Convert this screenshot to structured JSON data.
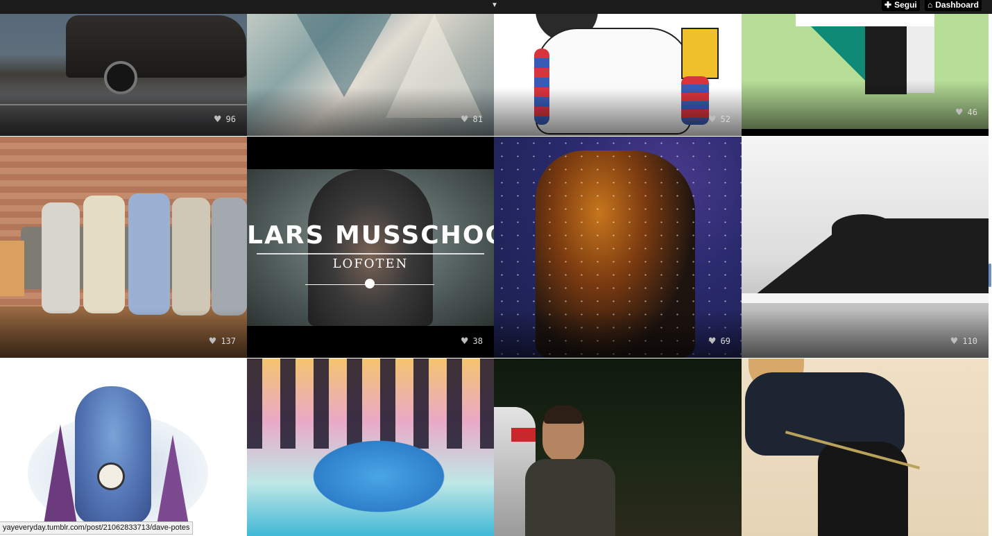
{
  "topbar": {
    "toggle_icon": "chevron-down-icon",
    "follow_label": "Segui",
    "dashboard_label": "Dashboard"
  },
  "posts": [
    {
      "likes": "96",
      "subject": "van"
    },
    {
      "likes": "81",
      "subject": "abstract-shards"
    },
    {
      "likes": "52",
      "subject": "illustration"
    },
    {
      "likes": "46",
      "subject": "geometric-logo"
    },
    {
      "likes": "137",
      "subject": "band-on-couch"
    },
    {
      "likes": "38",
      "subject": "video-still"
    },
    {
      "likes": "69",
      "subject": "space-portrait"
    },
    {
      "likes": "110",
      "subject": "mountain"
    },
    {
      "likes": "",
      "subject": "monster-banjo"
    },
    {
      "likes": "",
      "subject": "psychedelic-painting"
    },
    {
      "likes": "",
      "subject": "night-portrait"
    },
    {
      "likes": "",
      "subject": "cyclist"
    }
  ],
  "video_overlay": {
    "title": "LARS MUSSCHOOT",
    "subtitle": "LOFOTEN"
  },
  "status_bar": {
    "url": "yayeveryday.tumblr.com/post/21062833713/dave-potes"
  },
  "colors": {
    "topbar_bg": "#1b1b1b",
    "scroll_thumb": "#6a8fc7"
  }
}
